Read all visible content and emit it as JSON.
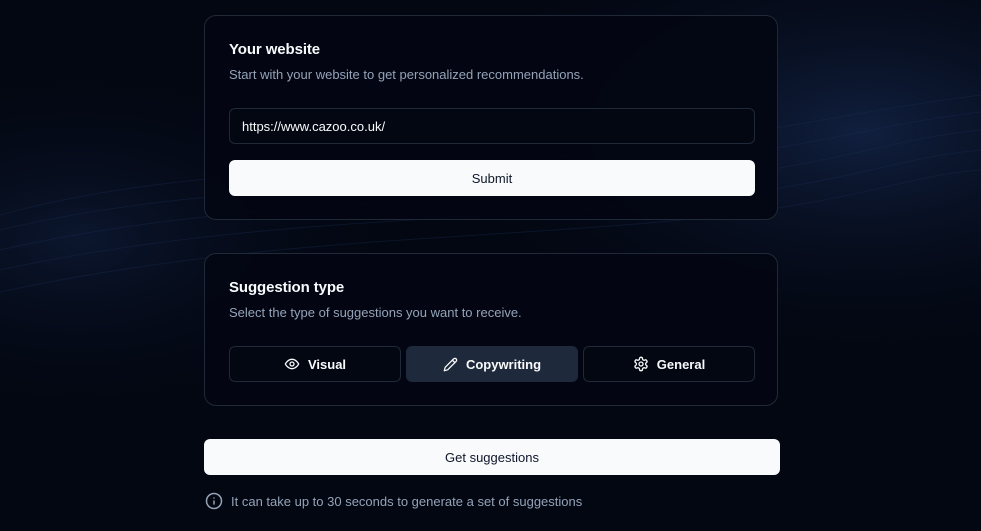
{
  "website_card": {
    "title": "Your website",
    "description": "Start with your website to get personalized recommendations.",
    "url_value": "https://www.cazoo.co.uk/",
    "submit_label": "Submit"
  },
  "suggestion_card": {
    "title": "Suggestion type",
    "description": "Select the type of suggestions you want to receive.",
    "options": [
      {
        "label": "Visual",
        "icon": "eye-icon",
        "selected": false
      },
      {
        "label": "Copywriting",
        "icon": "pencil-icon",
        "selected": true
      },
      {
        "label": "General",
        "icon": "gear-icon",
        "selected": false
      }
    ]
  },
  "get_suggestions_label": "Get suggestions",
  "info_note": "It can take up to 30 seconds to generate a set of suggestions",
  "colors": {
    "background": "#030712",
    "card_border": "#1f2937",
    "selected_option": "#1e293b",
    "primary_button": "#f8fafc",
    "muted_text": "#94a3b8"
  }
}
